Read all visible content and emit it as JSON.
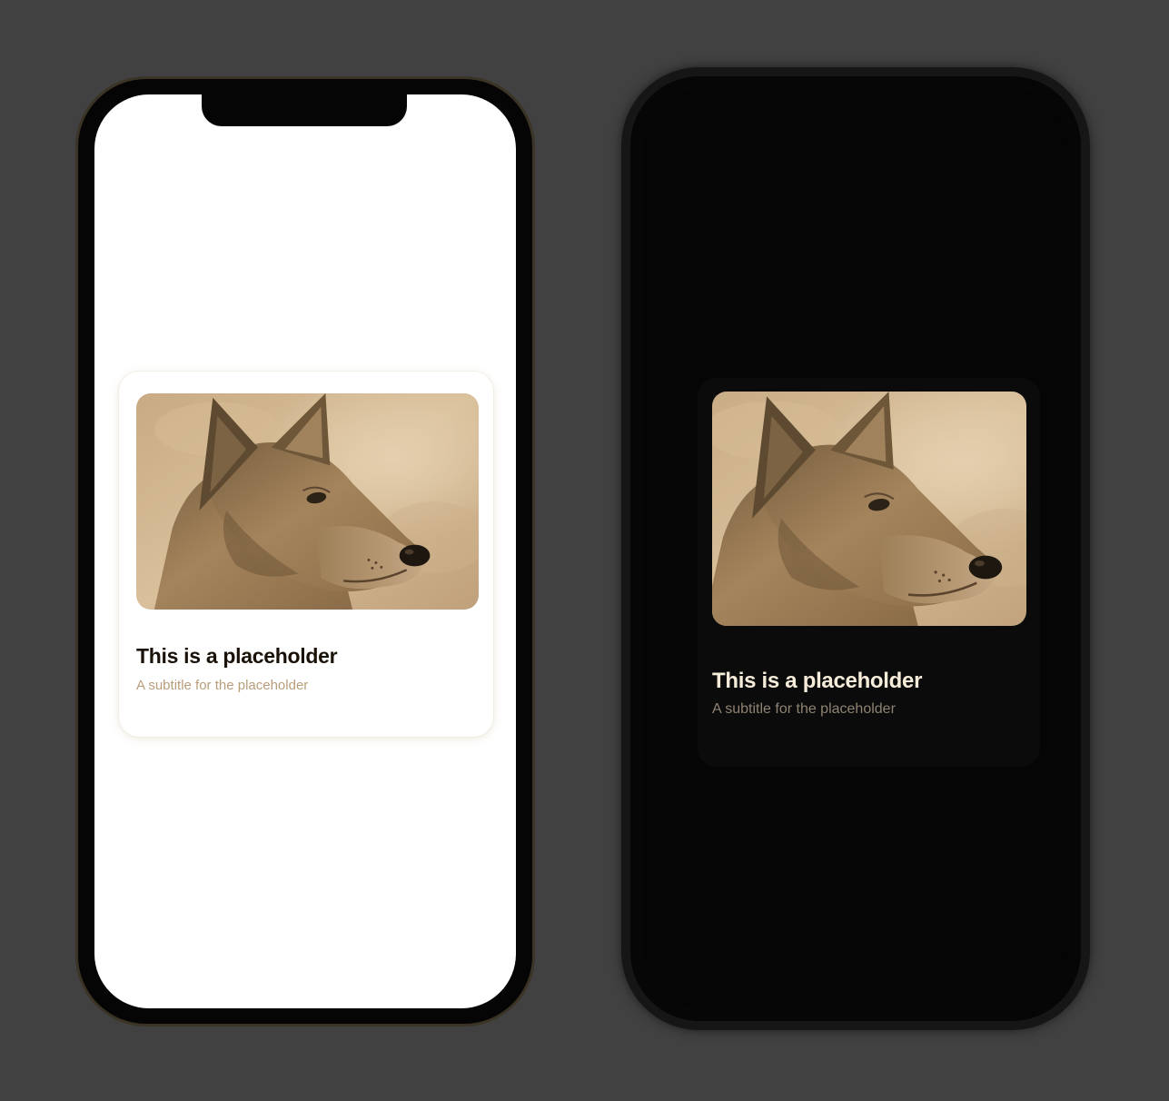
{
  "light_phone": {
    "theme": "light",
    "screen_color": "#ffffff",
    "card": {
      "image_alt": "dog",
      "title": "This is a placeholder",
      "subtitle": "A subtitle for the placeholder",
      "title_color": "#1a1208",
      "subtitle_color": "#b99d7a"
    }
  },
  "dark_phone": {
    "theme": "dark",
    "screen_color": "#050505",
    "card": {
      "image_alt": "dog",
      "title": "This is a placeholder",
      "subtitle": "A subtitle for the placeholder",
      "title_color": "#f6ecda",
      "subtitle_color": "#8f8372"
    }
  },
  "colors": {
    "backdrop": "#414141",
    "photo_tone": "#c9a97f"
  }
}
